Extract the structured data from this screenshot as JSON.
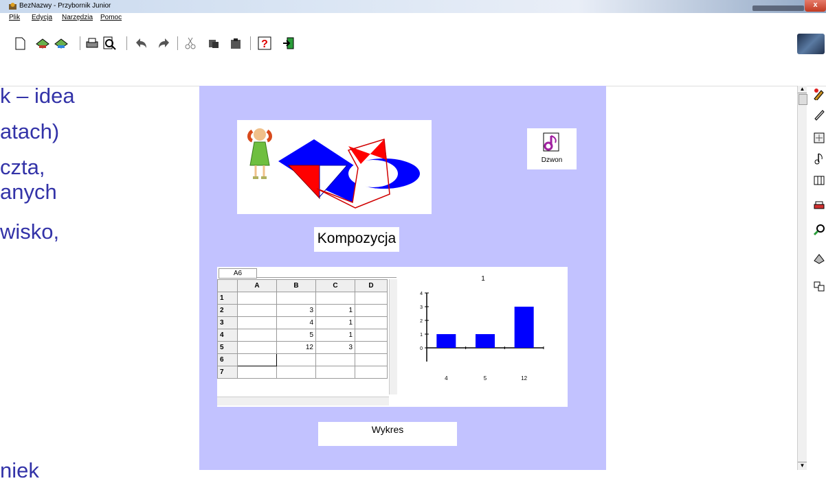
{
  "window": {
    "title": "BezNazwy - Przybornik Junior",
    "close_label": "x"
  },
  "menu": {
    "items": [
      "Plik",
      "Edycja",
      "Narzędzia",
      "Pomoc"
    ]
  },
  "toolbar": {
    "icons": [
      "new-icon",
      "open-icon",
      "save-icon",
      "print-icon",
      "preview-icon",
      "undo-icon",
      "redo-icon",
      "cut-icon",
      "copy-icon",
      "paste-icon",
      "help-icon",
      "exit-icon"
    ]
  },
  "slide_text": [
    "k – idea",
    "atach)",
    "czta,",
    "anych",
    "wisko,",
    "niek"
  ],
  "canvas": {
    "dzwon_label": "Dzwon",
    "kompozycja_label": "Kompozycja",
    "wykres_label": "Wykres",
    "spreadsheet": {
      "cell_ref": "A6",
      "columns": [
        "A",
        "B",
        "C",
        "D"
      ],
      "rows": [
        {
          "n": "1",
          "a": "",
          "b": "",
          "c": "",
          "d": ""
        },
        {
          "n": "2",
          "a": "",
          "b": "3",
          "c": "1",
          "d": ""
        },
        {
          "n": "3",
          "a": "",
          "b": "4",
          "c": "1",
          "d": ""
        },
        {
          "n": "4",
          "a": "",
          "b": "5",
          "c": "1",
          "d": ""
        },
        {
          "n": "5",
          "a": "",
          "b": "12",
          "c": "3",
          "d": ""
        },
        {
          "n": "6",
          "a": "",
          "b": "",
          "c": "",
          "d": ""
        },
        {
          "n": "7",
          "a": "",
          "b": "",
          "c": "",
          "d": ""
        }
      ]
    }
  },
  "chart_data": {
    "type": "bar",
    "title": "1",
    "categories": [
      "4",
      "5",
      "12"
    ],
    "values": [
      1,
      1,
      3
    ],
    "ylim": [
      0,
      4
    ],
    "yticks": [
      "0",
      "1",
      "2",
      "3",
      "4"
    ],
    "color": "#0000ff"
  },
  "colors": {
    "canvas_bg": "#c2c2ff",
    "slide_text": "#3333a8"
  }
}
